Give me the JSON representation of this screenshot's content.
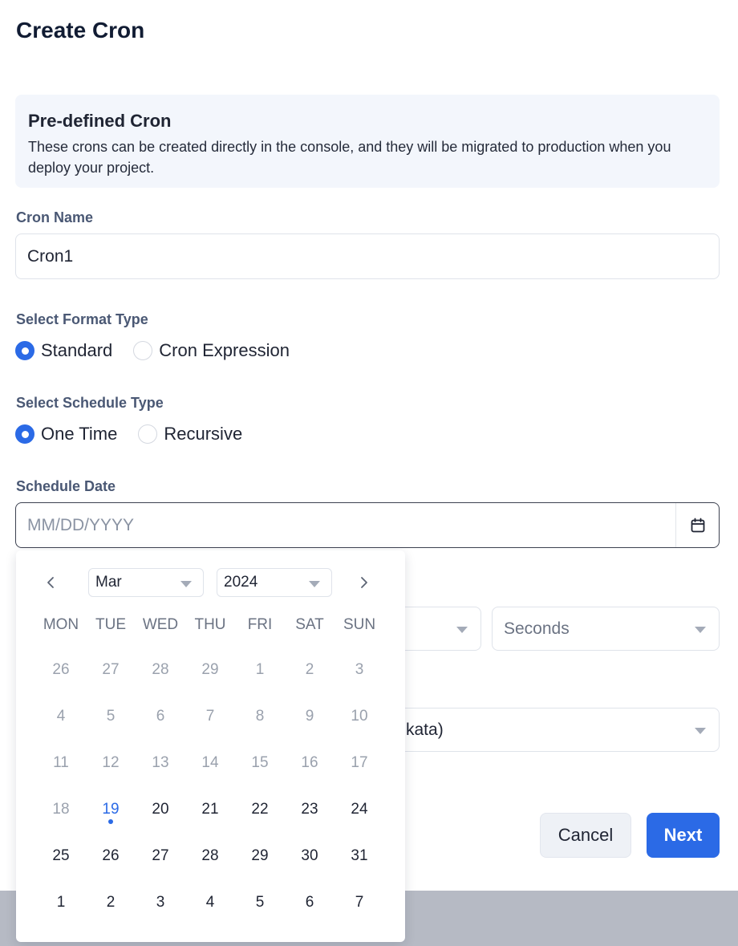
{
  "title": "Create Cron",
  "info": {
    "heading": "Pre-defined Cron",
    "text": "These crons can be created directly in the console, and they will be migrated to production when you deploy your project."
  },
  "cron_name": {
    "label": "Cron Name",
    "value": "Cron1"
  },
  "format_type": {
    "label": "Select Format Type",
    "options": [
      {
        "label": "Standard",
        "checked": true
      },
      {
        "label": "Cron Expression",
        "checked": false
      }
    ]
  },
  "schedule_type": {
    "label": "Select Schedule Type",
    "options": [
      {
        "label": "One Time",
        "checked": true
      },
      {
        "label": "Recursive",
        "checked": false
      }
    ]
  },
  "schedule_date": {
    "label": "Schedule Date",
    "placeholder": "MM/DD/YYYY",
    "value": ""
  },
  "time_unit_select": {
    "value": "Seconds"
  },
  "timezone_select": {
    "visible_text": "kata)"
  },
  "buttons": {
    "cancel": "Cancel",
    "next": "Next"
  },
  "calendar": {
    "month": "Mar",
    "year": "2024",
    "weekdays": [
      "MON",
      "TUE",
      "WED",
      "THU",
      "FRI",
      "SAT",
      "SUN"
    ],
    "today": "19",
    "weeks": [
      [
        {
          "d": "26",
          "m": true
        },
        {
          "d": "27",
          "m": true
        },
        {
          "d": "28",
          "m": true
        },
        {
          "d": "29",
          "m": true
        },
        {
          "d": "1",
          "m": true
        },
        {
          "d": "2",
          "m": true
        },
        {
          "d": "3",
          "m": true
        }
      ],
      [
        {
          "d": "4",
          "m": true
        },
        {
          "d": "5",
          "m": true
        },
        {
          "d": "6",
          "m": true
        },
        {
          "d": "7",
          "m": true
        },
        {
          "d": "8",
          "m": true
        },
        {
          "d": "9",
          "m": true
        },
        {
          "d": "10",
          "m": true
        }
      ],
      [
        {
          "d": "11",
          "m": true
        },
        {
          "d": "12",
          "m": true
        },
        {
          "d": "13",
          "m": true
        },
        {
          "d": "14",
          "m": true
        },
        {
          "d": "15",
          "m": true
        },
        {
          "d": "16",
          "m": true
        },
        {
          "d": "17",
          "m": true
        }
      ],
      [
        {
          "d": "18",
          "m": true
        },
        {
          "d": "19",
          "m": false,
          "today": true
        },
        {
          "d": "20",
          "m": false
        },
        {
          "d": "21",
          "m": false
        },
        {
          "d": "22",
          "m": false
        },
        {
          "d": "23",
          "m": false
        },
        {
          "d": "24",
          "m": false
        }
      ],
      [
        {
          "d": "25",
          "m": false
        },
        {
          "d": "26",
          "m": false
        },
        {
          "d": "27",
          "m": false
        },
        {
          "d": "28",
          "m": false
        },
        {
          "d": "29",
          "m": false
        },
        {
          "d": "30",
          "m": false
        },
        {
          "d": "31",
          "m": false
        }
      ],
      [
        {
          "d": "1",
          "m": false
        },
        {
          "d": "2",
          "m": false
        },
        {
          "d": "3",
          "m": false
        },
        {
          "d": "4",
          "m": false
        },
        {
          "d": "5",
          "m": false
        },
        {
          "d": "6",
          "m": false
        },
        {
          "d": "7",
          "m": false
        }
      ]
    ]
  },
  "colors": {
    "accent": "#2b6ae6",
    "muted_day": "#9aa1ad",
    "info_bg": "#f3f6fc"
  },
  "icons": {
    "calendar": "calendar-icon",
    "prev": "chevron-left-icon",
    "next": "chevron-right-icon",
    "dropdown": "chevron-down-icon"
  }
}
